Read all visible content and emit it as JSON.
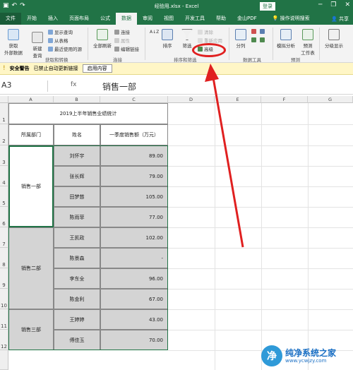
{
  "window": {
    "title": "经验用.xlsx  -  Excel",
    "login_label": "登录",
    "minimize": "─",
    "restore": "❐",
    "close": "✕",
    "undo": "↶",
    "redo": "↷",
    "save": "▣"
  },
  "tabs": [
    "文件",
    "开始",
    "插入",
    "页面布局",
    "公式",
    "数据",
    "审阅",
    "视图",
    "开发工具",
    "帮助",
    "金山PDF"
  ],
  "active_tab": "数据",
  "tell_me": "操作说明搜索",
  "share": "共享",
  "ribbon": {
    "get_data": "获取\n外部数据",
    "new_query": "新建\n查询",
    "show_query": "显示查询",
    "from_table": "从表格",
    "recent_sources": "最近使用的源",
    "group_get_transform": "获取和转换",
    "refresh_all": "全部刷新",
    "connections": "连接",
    "properties": "属性",
    "edit_links": "编辑链接",
    "group_connections": "连接",
    "sort_az": "A↓Z",
    "sort": "排序",
    "filter": "筛选",
    "clear": "清除",
    "reapply": "重新应用",
    "advanced": "高级",
    "group_sort_filter": "排序和筛选",
    "text_to_columns": "分列",
    "group_data_tools": "数据工具",
    "what_if": "模拟分析",
    "forecast_sheet": "预测\n工作表",
    "group_forecast": "预测",
    "outline": "分级显示"
  },
  "security_bar": {
    "title": "安全警告",
    "message": "已禁止自动更新链接",
    "enable_button": "启用内容"
  },
  "formula_bar": {
    "name_box": "A3",
    "fx": "fx",
    "content": "销售一部"
  },
  "columns": [
    "A",
    "B",
    "C",
    "D",
    "E",
    "F",
    "G"
  ],
  "rows": [
    "1",
    "2",
    "3",
    "4",
    "5",
    "6",
    "7",
    "8",
    "9",
    "10",
    "11",
    "12"
  ],
  "sheet": {
    "title": "2019上半年销售业绩统计",
    "headers": [
      "所属部门",
      "姓名",
      "一季度销售额（万元）"
    ],
    "departments": [
      "销售一部",
      "销售二部",
      "销售三部"
    ],
    "records": [
      {
        "name": "刘怀宇",
        "value": "89.00"
      },
      {
        "name": "张长辉",
        "value": "79.00"
      },
      {
        "name": "田梦慈",
        "value": "105.00"
      },
      {
        "name": "陈雨菲",
        "value": "77.00"
      },
      {
        "name": "王凯政",
        "value": "102.00"
      },
      {
        "name": "陈景森",
        "value": "-"
      },
      {
        "name": "李东全",
        "value": "96.00"
      },
      {
        "name": "陈金利",
        "value": "67.00"
      },
      {
        "name": "王婷婷",
        "value": "43.00"
      },
      {
        "name": "傅佳玉",
        "value": "70.00"
      }
    ]
  },
  "watermark": {
    "logo": "净",
    "name": "纯净系统之家",
    "url": "www.ycwjzy.com"
  },
  "colors": {
    "excel_green": "#217346",
    "arrow_red": "#e02020"
  }
}
